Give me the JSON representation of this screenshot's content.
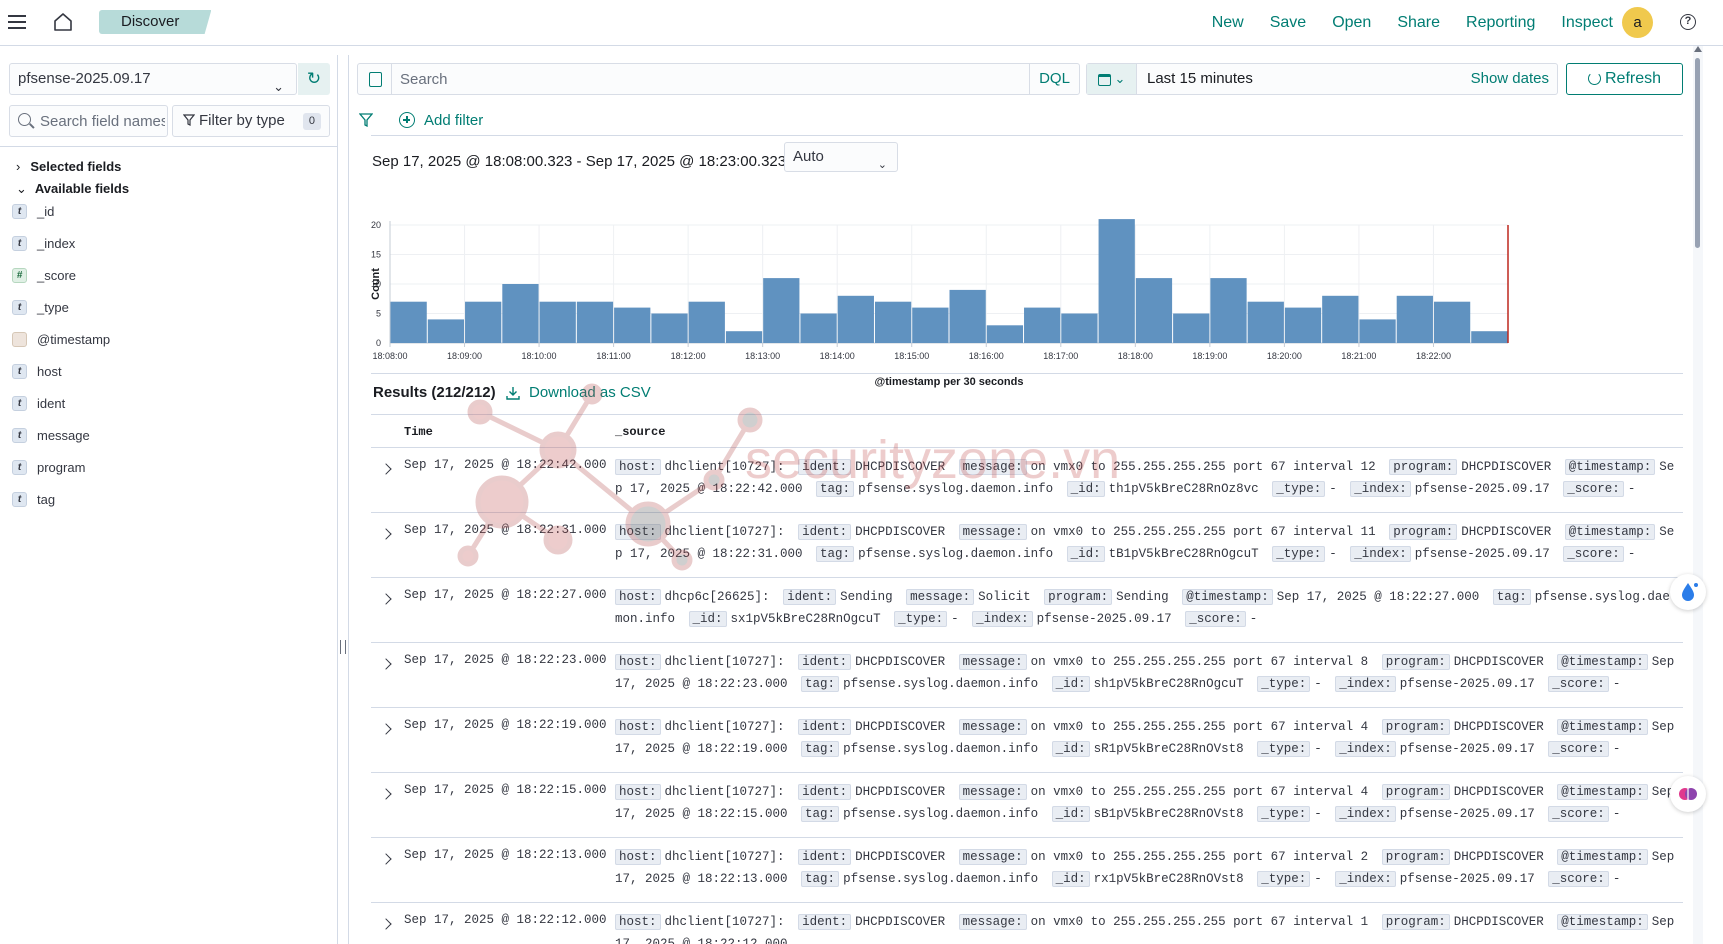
{
  "header": {
    "breadcrumb": "Discover",
    "links": [
      "New",
      "Save",
      "Open",
      "Share",
      "Reporting",
      "Inspect"
    ],
    "avatar_letter": "a"
  },
  "sidebar": {
    "index_pattern": "pfsense-2025.09.17",
    "field_search_placeholder": "Search field names",
    "filter_by_type": "Filter by type",
    "filter_count": "0",
    "selected_fields": "Selected fields",
    "available_fields": "Available fields",
    "fields": [
      {
        "type": "t",
        "name": "_id"
      },
      {
        "type": "t",
        "name": "_index"
      },
      {
        "type": "#",
        "name": "_score"
      },
      {
        "type": "t",
        "name": "_type"
      },
      {
        "type": "date",
        "name": "@timestamp"
      },
      {
        "type": "t",
        "name": "host"
      },
      {
        "type": "t",
        "name": "ident"
      },
      {
        "type": "t",
        "name": "message"
      },
      {
        "type": "t",
        "name": "program"
      },
      {
        "type": "t",
        "name": "tag"
      }
    ]
  },
  "query": {
    "search_placeholder": "Search",
    "language": "DQL",
    "time_range": "Last 15 minutes",
    "show_dates": "Show dates",
    "refresh": "Refresh",
    "add_filter": "Add filter"
  },
  "histogram": {
    "range_label": "Sep 17, 2025 @ 18:08:00.323 - Sep 17, 2025 @ 18:23:00.323 per",
    "interval": "Auto"
  },
  "chart_data": {
    "type": "bar",
    "title": "",
    "xlabel": "@timestamp per 30 seconds",
    "ylabel": "Count",
    "ylim": [
      0,
      20
    ],
    "yticks": [
      0,
      5,
      10,
      15,
      20
    ],
    "xticks": [
      "18:08:00",
      "18:09:00",
      "18:10:00",
      "18:11:00",
      "18:12:00",
      "18:13:00",
      "18:14:00",
      "18:15:00",
      "18:16:00",
      "18:17:00",
      "18:18:00",
      "18:19:00",
      "18:20:00",
      "18:21:00",
      "18:22:00"
    ],
    "values": [
      7,
      4,
      7,
      10,
      7,
      7,
      6,
      5,
      7,
      2,
      11,
      5,
      8,
      7,
      6,
      9,
      3,
      6,
      5,
      21,
      11,
      5,
      11,
      7,
      6,
      8,
      4,
      8,
      7,
      2
    ],
    "color": "#6092c0",
    "marker_color": "#bd271e"
  },
  "results": {
    "label": "Results (212/212)",
    "download": "Download as CSV",
    "col_time": "Time",
    "col_source": "_source",
    "rows": [
      {
        "time": "Sep 17, 2025 @ 18:22:42.000",
        "fields": [
          [
            "host:",
            "dhclient[10727]:"
          ],
          [
            "ident:",
            "DHCPDISCOVER"
          ],
          [
            "message:",
            "on vmx0 to 255.255.255.255 port 67 interval 12"
          ],
          [
            "program:",
            "DHCPDISCOVER"
          ],
          [
            "@timestamp:",
            "Sep 17, 2025 @ 18:22:42.000"
          ],
          [
            "tag:",
            "pfsense.syslog.daemon.info"
          ],
          [
            "_id:",
            "th1pV5kBreC28RnOz8vc"
          ],
          [
            "_type:",
            "-"
          ],
          [
            "_index:",
            "pfsense-2025.09.17"
          ],
          [
            "_score:",
            "-"
          ]
        ]
      },
      {
        "time": "Sep 17, 2025 @ 18:22:31.000",
        "fields": [
          [
            "host:",
            "dhclient[10727]:"
          ],
          [
            "ident:",
            "DHCPDISCOVER"
          ],
          [
            "message:",
            "on vmx0 to 255.255.255.255 port 67 interval 11"
          ],
          [
            "program:",
            "DHCPDISCOVER"
          ],
          [
            "@timestamp:",
            "Sep 17, 2025 @ 18:22:31.000"
          ],
          [
            "tag:",
            "pfsense.syslog.daemon.info"
          ],
          [
            "_id:",
            "tB1pV5kBreC28RnOgcuT"
          ],
          [
            "_type:",
            "-"
          ],
          [
            "_index:",
            "pfsense-2025.09.17"
          ],
          [
            "_score:",
            "-"
          ]
        ]
      },
      {
        "time": "Sep 17, 2025 @ 18:22:27.000",
        "fields": [
          [
            "host:",
            "dhcp6c[26625]:"
          ],
          [
            "ident:",
            "Sending"
          ],
          [
            "message:",
            "Solicit"
          ],
          [
            "program:",
            "Sending"
          ],
          [
            "@timestamp:",
            "Sep 17, 2025 @ 18:22:27.000"
          ],
          [
            "tag:",
            "pfsense.syslog.daemon.info"
          ],
          [
            "_id:",
            "sx1pV5kBreC28RnOgcuT"
          ],
          [
            "_type:",
            "-"
          ],
          [
            "_index:",
            "pfsense-2025.09.17"
          ],
          [
            "_score:",
            "-"
          ]
        ]
      },
      {
        "time": "Sep 17, 2025 @ 18:22:23.000",
        "fields": [
          [
            "host:",
            "dhclient[10727]:"
          ],
          [
            "ident:",
            "DHCPDISCOVER"
          ],
          [
            "message:",
            "on vmx0 to 255.255.255.255 port 67 interval 8"
          ],
          [
            "program:",
            "DHCPDISCOVER"
          ],
          [
            "@timestamp:",
            "Sep 17, 2025 @ 18:22:23.000"
          ],
          [
            "tag:",
            "pfsense.syslog.daemon.info"
          ],
          [
            "_id:",
            "sh1pV5kBreC28RnOgcuT"
          ],
          [
            "_type:",
            "-"
          ],
          [
            "_index:",
            "pfsense-2025.09.17"
          ],
          [
            "_score:",
            "-"
          ]
        ]
      },
      {
        "time": "Sep 17, 2025 @ 18:22:19.000",
        "fields": [
          [
            "host:",
            "dhclient[10727]:"
          ],
          [
            "ident:",
            "DHCPDISCOVER"
          ],
          [
            "message:",
            "on vmx0 to 255.255.255.255 port 67 interval 4"
          ],
          [
            "program:",
            "DHCPDISCOVER"
          ],
          [
            "@timestamp:",
            "Sep 17, 2025 @ 18:22:19.000"
          ],
          [
            "tag:",
            "pfsense.syslog.daemon.info"
          ],
          [
            "_id:",
            "sR1pV5kBreC28RnOVst8"
          ],
          [
            "_type:",
            "-"
          ],
          [
            "_index:",
            "pfsense-2025.09.17"
          ],
          [
            "_score:",
            "-"
          ]
        ]
      },
      {
        "time": "Sep 17, 2025 @ 18:22:15.000",
        "fields": [
          [
            "host:",
            "dhclient[10727]:"
          ],
          [
            "ident:",
            "DHCPDISCOVER"
          ],
          [
            "message:",
            "on vmx0 to 255.255.255.255 port 67 interval 4"
          ],
          [
            "program:",
            "DHCPDISCOVER"
          ],
          [
            "@timestamp:",
            "Sep 17, 2025 @ 18:22:15.000"
          ],
          [
            "tag:",
            "pfsense.syslog.daemon.info"
          ],
          [
            "_id:",
            "sB1pV5kBreC28RnOVst8"
          ],
          [
            "_type:",
            "-"
          ],
          [
            "_index:",
            "pfsense-2025.09.17"
          ],
          [
            "_score:",
            "-"
          ]
        ]
      },
      {
        "time": "Sep 17, 2025 @ 18:22:13.000",
        "fields": [
          [
            "host:",
            "dhclient[10727]:"
          ],
          [
            "ident:",
            "DHCPDISCOVER"
          ],
          [
            "message:",
            "on vmx0 to 255.255.255.255 port 67 interval 2"
          ],
          [
            "program:",
            "DHCPDISCOVER"
          ],
          [
            "@timestamp:",
            "Sep 17, 2025 @ 18:22:13.000"
          ],
          [
            "tag:",
            "pfsense.syslog.daemon.info"
          ],
          [
            "_id:",
            "rx1pV5kBreC28RnOVst8"
          ],
          [
            "_type:",
            "-"
          ],
          [
            "_index:",
            "pfsense-2025.09.17"
          ],
          [
            "_score:",
            "-"
          ]
        ]
      },
      {
        "time": "Sep 17, 2025 @ 18:22:12.000",
        "fields": [
          [
            "host:",
            "dhclient[10727]:"
          ],
          [
            "ident:",
            "DHCPDISCOVER"
          ],
          [
            "message:",
            "on vmx0 to 255.255.255.255 port 67 interval 1"
          ],
          [
            "program:",
            "DHCPDISCOVER"
          ],
          [
            "@timestamp:",
            "Sep 17, 2025 @ 18:22:12.000"
          ]
        ]
      }
    ]
  },
  "watermark": "securityzone.vn"
}
